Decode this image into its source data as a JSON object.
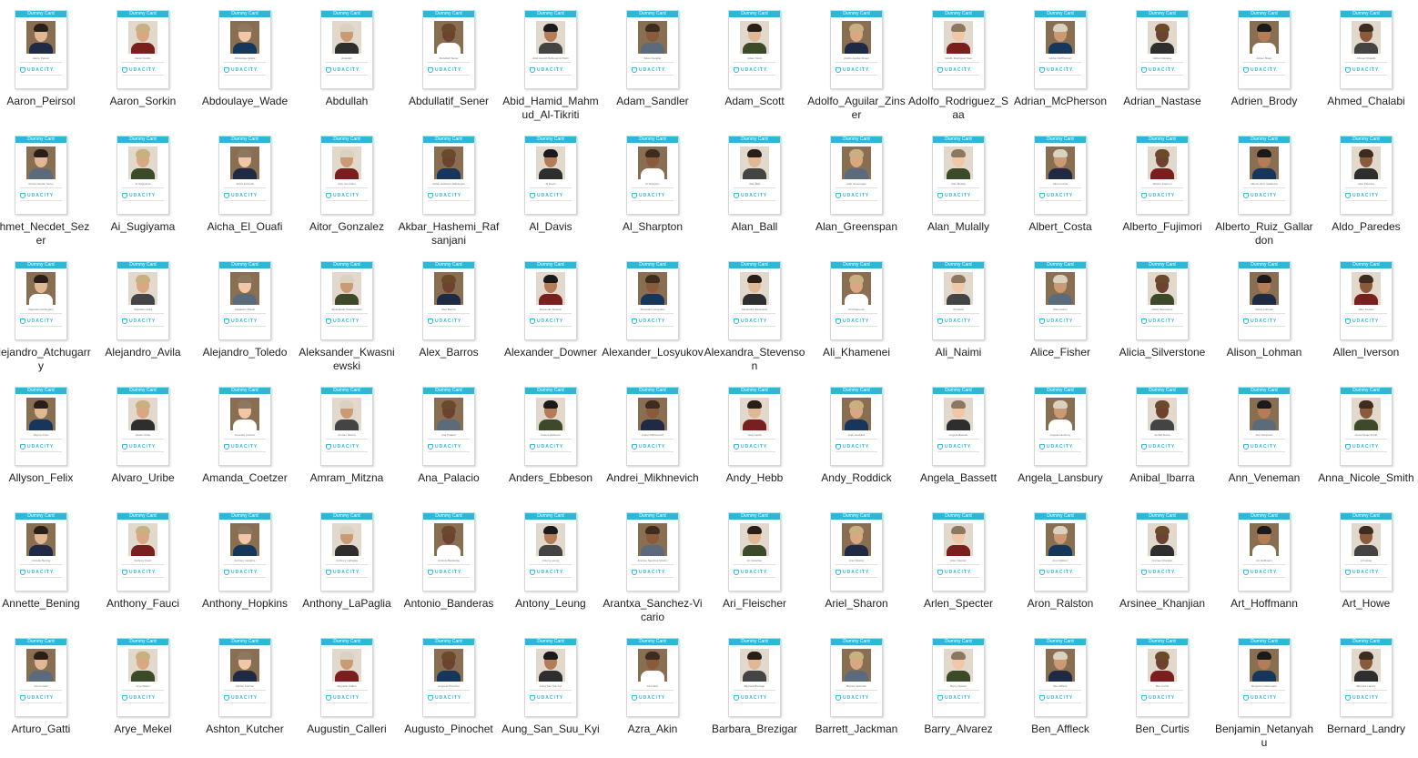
{
  "card_header": "Dummy Card",
  "card_brand": "UDACITY",
  "file_icon": "image-file-thumbnail-icon",
  "accent_color": "#2fb8d6",
  "files": [
    "Aaron_Peirsol",
    "Aaron_Sorkin",
    "Abdoulaye_Wade",
    "Abdullah",
    "Abdullatif_Sener",
    "Abid_Hamid_Mahmud_Al-Tikriti",
    "Adam_Sandler",
    "Adam_Scott",
    "Adolfo_Aguilar_Zinser",
    "Adolfo_Rodriguez_Saa",
    "Adrian_McPherson",
    "Adrian_Nastase",
    "Adrien_Brody",
    "Ahmed_Chalabi",
    "Ahmet_Necdet_Sezer",
    "Ai_Sugiyama",
    "Aicha_El_Ouafi",
    "Aitor_Gonzalez",
    "Akbar_Hashemi_Rafsanjani",
    "Al_Davis",
    "Al_Sharpton",
    "Alan_Ball",
    "Alan_Greenspan",
    "Alan_Mulally",
    "Albert_Costa",
    "Alberto_Fujimori",
    "Alberto_Ruiz_Gallardon",
    "Aldo_Paredes",
    "Alejandro_Atchugarry",
    "Alejandro_Avila",
    "Alejandro_Toledo",
    "Aleksander_Kwasniewski",
    "Alex_Barros",
    "Alexander_Downer",
    "Alexander_Losyukov",
    "Alexandra_Stevenson",
    "Ali_Khamenei",
    "Ali_Naimi",
    "Alice_Fisher",
    "Alicia_Silverstone",
    "Alison_Lohman",
    "Allen_Iverson",
    "Allyson_Felix",
    "Alvaro_Uribe",
    "Amanda_Coetzer",
    "Amram_Mitzna",
    "Ana_Palacio",
    "Anders_Ebbeson",
    "Andrei_Mikhnevich",
    "Andy_Hebb",
    "Andy_Roddick",
    "Angela_Bassett",
    "Angela_Lansbury",
    "Anibal_Ibarra",
    "Ann_Veneman",
    "Anna_Nicole_Smith",
    "Annette_Bening",
    "Anthony_Fauci",
    "Anthony_Hopkins",
    "Anthony_LaPaglia",
    "Antonio_Banderas",
    "Antony_Leung",
    "Arantxa_Sanchez-Vicario",
    "Ari_Fleischer",
    "Ariel_Sharon",
    "Arlen_Specter",
    "Aron_Ralston",
    "Arsinee_Khanjian",
    "Art_Hoffmann",
    "Art_Howe",
    "Arturo_Gatti",
    "Arye_Mekel",
    "Ashton_Kutcher",
    "Augustin_Calleri",
    "Augusto_Pinochet",
    "Aung_San_Suu_Kyi",
    "Azra_Akin",
    "Barbara_Brezigar",
    "Barrett_Jackman",
    "Barry_Alvarez",
    "Ben_Affleck",
    "Ben_Curtis",
    "Benjamin_Netanyahu",
    "Bernard_Landry"
  ],
  "labels": [
    [
      "Aaron_Peirsol"
    ],
    [
      "Aaron_Sorkin"
    ],
    [
      "Abdoulaye_Wade"
    ],
    [
      "Abdullah"
    ],
    [
      "Abdullatif_Sener"
    ],
    [
      "Abid_Hamid_Mah",
      "mud_Al-Tikriti"
    ],
    [
      "Adam_Sandler"
    ],
    [
      "Adam_Scott"
    ],
    [
      "Adolfo_Aguilar_Zi",
      "nser"
    ],
    [
      "Adolfo_Rodriguez",
      "_Saa"
    ],
    [
      "Adrian_McPherso",
      "n"
    ],
    [
      "Adrian_Nastase"
    ],
    [
      "Adrien_Brody"
    ],
    [
      "Ahmed_Chalabi"
    ],
    [
      "Ahmet_Necdet_Se",
      "zer"
    ],
    [
      "Ai_Sugiyama"
    ],
    [
      "Aicha_El_Ouafi"
    ],
    [
      "Aitor_Gonzalez"
    ],
    [
      "Akbar_Hashemi_R",
      "afsanjani"
    ],
    [
      "Al_Davis"
    ],
    [
      "Al_Sharpton"
    ],
    [
      "Alan_Ball"
    ],
    [
      "Alan_Greenspan"
    ],
    [
      "Alan_Mulally"
    ],
    [
      "Albert_Costa"
    ],
    [
      "Alberto_Fujimori"
    ],
    [
      "Alberto_Ruiz_Galla",
      "rdon"
    ],
    [
      "Aldo_Paredes"
    ],
    [
      "Alejandro_Atchug",
      "arry"
    ],
    [
      "Alejandro_Avila"
    ],
    [
      "Alejandro_Toledo"
    ],
    [
      "Aleksander_Kwasn",
      "iewski"
    ],
    [
      "Alex_Barros"
    ],
    [
      "Alexander_Downer"
    ],
    [
      "Alexander_Losyuk",
      "ov"
    ],
    [
      "Alexandra_Stevens",
      "on"
    ],
    [
      "Ali_Khamenei"
    ],
    [
      "Ali_Naimi"
    ],
    [
      "Alice_Fisher"
    ],
    [
      "Alicia_Silverstone"
    ],
    [
      "Alison_Lohman"
    ],
    [
      "Allen_Iverson"
    ],
    [
      "Allyson_Felix"
    ],
    [
      "Alvaro_Uribe"
    ],
    [
      "Amanda_Coetzer"
    ],
    [
      "Amram_Mitzna"
    ],
    [
      "Ana_Palacio"
    ],
    [
      "Anders_Ebbeson"
    ],
    [
      "Andrei_Mikhnevic",
      "h"
    ],
    [
      "Andy_Hebb"
    ],
    [
      "Andy_Roddick"
    ],
    [
      "Angela_Bassett"
    ],
    [
      "Angela_Lansbury"
    ],
    [
      "Anibal_Ibarra"
    ],
    [
      "Ann_Veneman"
    ],
    [
      "Anna_Nicole_Smit",
      "h"
    ],
    [
      "Annette_Bening"
    ],
    [
      "Anthony_Fauci"
    ],
    [
      "Anthony_Hopkins"
    ],
    [
      "Anthony_LaPaglia"
    ],
    [
      "Antonio_Banderas"
    ],
    [
      "Antony_Leung"
    ],
    [
      "Arantxa_Sanchez-",
      "Vicario"
    ],
    [
      "Ari_Fleischer"
    ],
    [
      "Ariel_Sharon"
    ],
    [
      "Arlen_Specter"
    ],
    [
      "Aron_Ralston"
    ],
    [
      "Arsinee_Khanjian"
    ],
    [
      "Art_Hoffmann"
    ],
    [
      "Art_Howe"
    ],
    [
      "Arturo_Gatti"
    ],
    [
      "Arye_Mekel"
    ],
    [
      "Ashton_Kutcher"
    ],
    [
      "Augustin_Calleri"
    ],
    [
      "Augusto_Pinochet"
    ],
    [
      "Aung_San_Suu_Kyi"
    ],
    [
      "Azra_Akin"
    ],
    [
      "Barbara_Brezigar"
    ],
    [
      "Barrett_Jackman"
    ],
    [
      "Barry_Alvarez"
    ],
    [
      "Ben_Affleck"
    ],
    [
      "Ben_Curtis"
    ],
    [
      "Benjamin_Netany",
      "ahu"
    ],
    [
      "Bernard_Landry"
    ]
  ]
}
